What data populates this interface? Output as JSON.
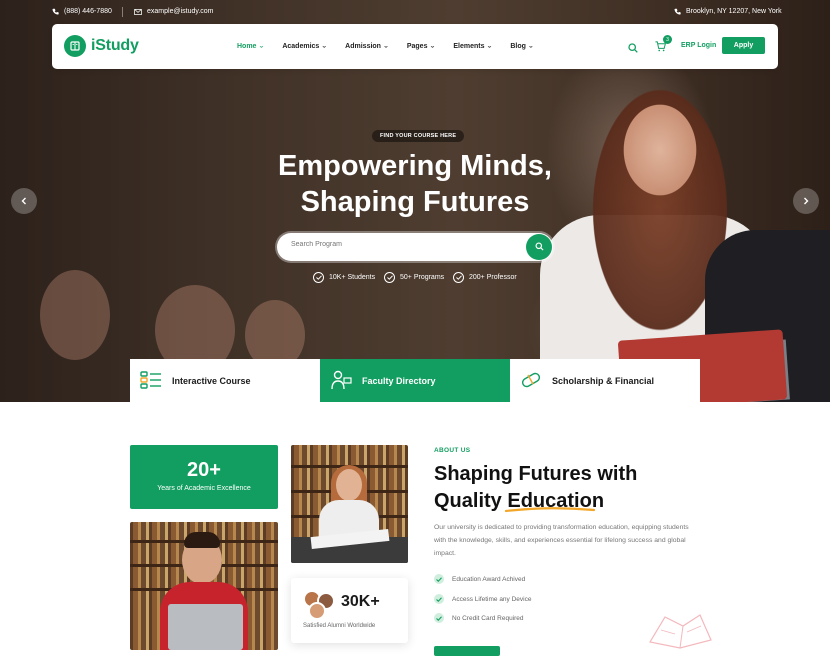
{
  "topbar": {
    "phone": "(888) 446-7880",
    "email": "example@istudy.com",
    "address": "Brooklyn, NY 12207, New York"
  },
  "nav": {
    "brand": "iStudy",
    "menu": [
      "Home",
      "Academics",
      "Admission",
      "Pages",
      "Elements",
      "Blog"
    ],
    "cart_count": "3",
    "erp_label": "ERP Login",
    "apply_label": "Apply"
  },
  "hero": {
    "eyebrow": "FIND YOUR COURSE HERE",
    "title_line1": "Empowering Minds,",
    "title_line2": "Shaping Futures",
    "search_placeholder": "Search Program",
    "stats": [
      "10K+ Students",
      "50+ Programs",
      "200+ Professor"
    ]
  },
  "features": [
    "Interactive Course",
    "Faculty Directory",
    "Scholarship & Financial"
  ],
  "about": {
    "years_value": "20+",
    "years_label": "Years of Academic Excellence",
    "alumni_value": "30K+",
    "alumni_label": "Satisfied Alumni Worldwide",
    "eyebrow": "ABOUT US",
    "title_line1": "Shaping Futures with",
    "title_line2_a": "Quality ",
    "title_line2_b": "Education",
    "description": "Our university is dedicated to providing transformation education, equipping students with the knowledge, skills, and experiences essential for lifelong success and global impact.",
    "checks": [
      "Education Award Achived",
      "Access Lifetime any Device",
      "No Credit Card Required"
    ]
  },
  "colors": {
    "brand": "#129e60",
    "accent_underline": "#f2a72a"
  }
}
